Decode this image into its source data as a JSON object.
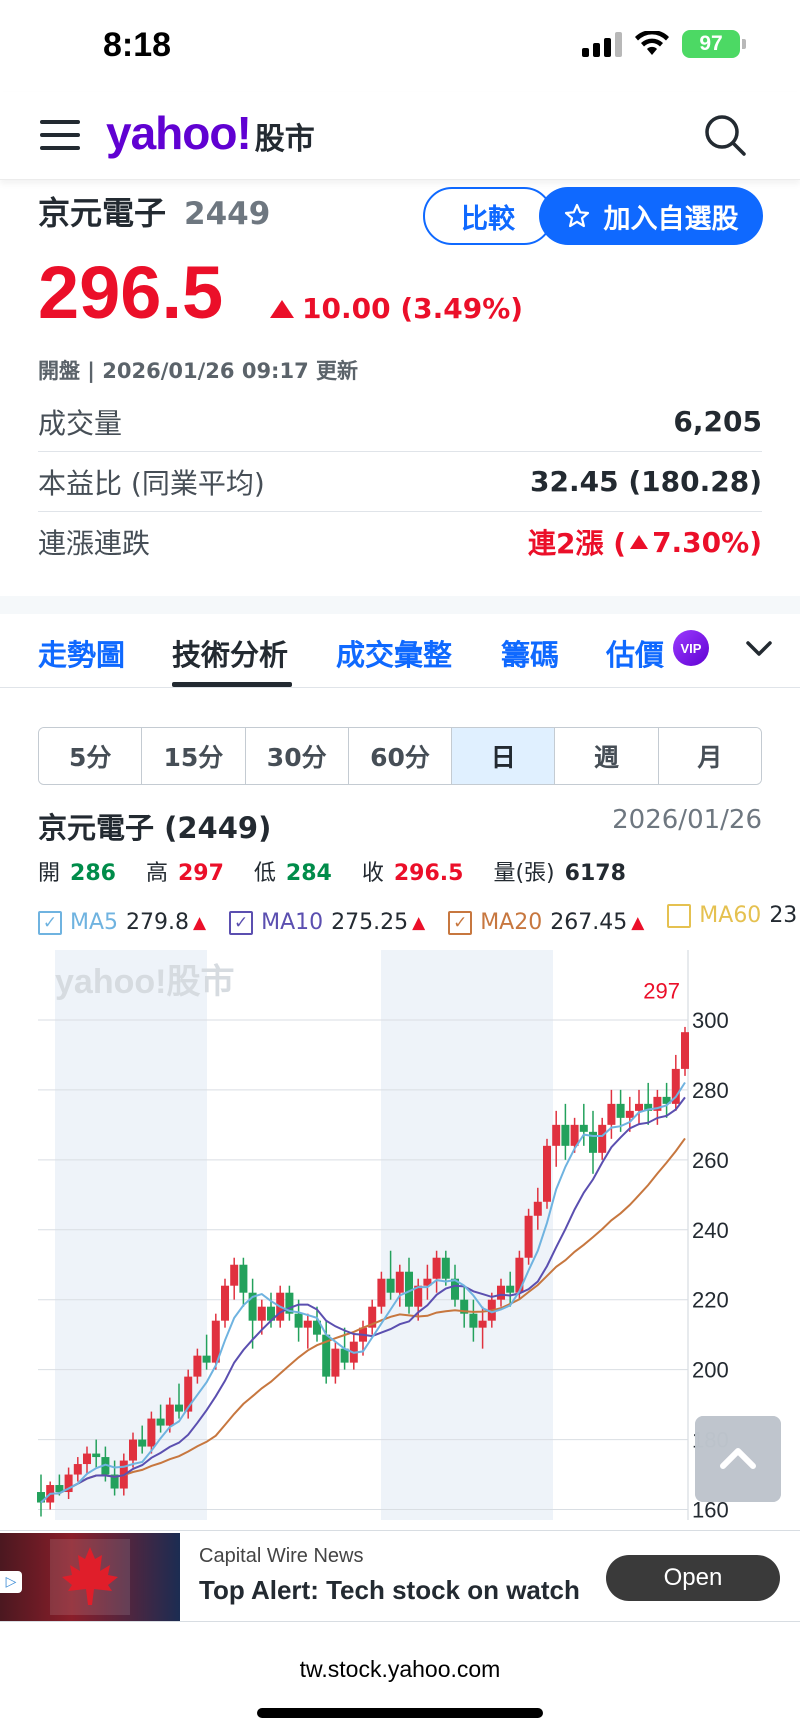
{
  "status_bar": {
    "time": "8:18",
    "battery": "97"
  },
  "header": {
    "logo_main": "yahoo!",
    "logo_sub": "股市"
  },
  "quote": {
    "name": "京元電子",
    "code": "2449",
    "compare_label": "比較",
    "watch_label": "加入自選股",
    "price": "296.5",
    "change": "10.00 (3.49%)",
    "update_info": "開盤 | 2026/01/26 09:17 更新",
    "stats": [
      {
        "label": "成交量",
        "value": "6,205"
      },
      {
        "label": "本益比 (同業平均)",
        "value": "32.45 (180.28)"
      },
      {
        "label": "連漲連跌",
        "value_prefix": "連2漲 (",
        "value_pct": "7.30%)"
      }
    ]
  },
  "tabs": [
    "走勢圖",
    "技術分析",
    "成交彙整",
    "籌碼",
    "估價"
  ],
  "vip_badge": "VIP",
  "periods": [
    "5分",
    "15分",
    "30分",
    "60分",
    "日",
    "週",
    "月"
  ],
  "active_period": "日",
  "chart_header": {
    "title": "京元電子 (2449)",
    "date": "2026/01/26",
    "open_label": "開",
    "open": "286",
    "high_label": "高",
    "high": "297",
    "low_label": "低",
    "low": "284",
    "close_label": "收",
    "close": "296.5",
    "volume_label": "量(張)",
    "volume": "6178"
  },
  "ma_legend": [
    {
      "name": "MA5",
      "value": "279.8",
      "color": "#6fb3e0"
    },
    {
      "name": "MA10",
      "value": "275.25",
      "color": "#5b4fb0"
    },
    {
      "name": "MA20",
      "value": "267.45",
      "color": "#c7773f"
    },
    {
      "name": "MA60",
      "value": "23",
      "color": "#e5c150"
    }
  ],
  "chart_data": {
    "type": "candlestick",
    "watermark": "yahoo!股市",
    "y_ticks": [
      300,
      280,
      260,
      240,
      220,
      200,
      180,
      160
    ],
    "ylim": [
      157,
      320
    ],
    "max_label": "297",
    "up_color": "#e0313f",
    "down_color": "#23a15c",
    "candles": [
      [
        165,
        170,
        158,
        162
      ],
      [
        162,
        168,
        160,
        167
      ],
      [
        167,
        170,
        164,
        165
      ],
      [
        165,
        172,
        163,
        170
      ],
      [
        170,
        175,
        168,
        173
      ],
      [
        173,
        178,
        170,
        176
      ],
      [
        176,
        180,
        172,
        175
      ],
      [
        175,
        178,
        168,
        170
      ],
      [
        170,
        174,
        164,
        166
      ],
      [
        166,
        176,
        164,
        174
      ],
      [
        174,
        182,
        172,
        180
      ],
      [
        180,
        184,
        176,
        178
      ],
      [
        178,
        188,
        176,
        186
      ],
      [
        186,
        190,
        182,
        184
      ],
      [
        184,
        192,
        182,
        190
      ],
      [
        190,
        196,
        186,
        188
      ],
      [
        188,
        200,
        186,
        198
      ],
      [
        198,
        206,
        196,
        204
      ],
      [
        204,
        210,
        200,
        202
      ],
      [
        202,
        216,
        200,
        214
      ],
      [
        214,
        226,
        212,
        224
      ],
      [
        224,
        232,
        220,
        230
      ],
      [
        230,
        232,
        218,
        222
      ],
      [
        222,
        226,
        206,
        214
      ],
      [
        214,
        220,
        210,
        218
      ],
      [
        218,
        222,
        212,
        214
      ],
      [
        214,
        224,
        212,
        222
      ],
      [
        222,
        224,
        214,
        216
      ],
      [
        216,
        220,
        208,
        212
      ],
      [
        212,
        216,
        206,
        214
      ],
      [
        214,
        218,
        208,
        210
      ],
      [
        210,
        214,
        196,
        198
      ],
      [
        198,
        208,
        196,
        206
      ],
      [
        206,
        212,
        200,
        202
      ],
      [
        202,
        210,
        200,
        208
      ],
      [
        208,
        214,
        204,
        212
      ],
      [
        212,
        220,
        210,
        218
      ],
      [
        218,
        228,
        216,
        226
      ],
      [
        226,
        234,
        220,
        222
      ],
      [
        222,
        230,
        218,
        228
      ],
      [
        228,
        232,
        216,
        218
      ],
      [
        218,
        226,
        214,
        224
      ],
      [
        224,
        230,
        220,
        226
      ],
      [
        226,
        234,
        222,
        232
      ],
      [
        232,
        234,
        224,
        226
      ],
      [
        226,
        230,
        218,
        220
      ],
      [
        220,
        224,
        212,
        216
      ],
      [
        216,
        220,
        208,
        212
      ],
      [
        212,
        218,
        206,
        214
      ],
      [
        214,
        222,
        212,
        220
      ],
      [
        220,
        226,
        218,
        224
      ],
      [
        224,
        228,
        218,
        222
      ],
      [
        222,
        234,
        220,
        232
      ],
      [
        232,
        246,
        230,
        244
      ],
      [
        244,
        252,
        240,
        248
      ],
      [
        248,
        266,
        246,
        264
      ],
      [
        264,
        274,
        258,
        270
      ],
      [
        270,
        276,
        260,
        264
      ],
      [
        264,
        272,
        262,
        270
      ],
      [
        270,
        276,
        264,
        268
      ],
      [
        268,
        274,
        256,
        262
      ],
      [
        262,
        272,
        260,
        270
      ],
      [
        270,
        280,
        266,
        276
      ],
      [
        276,
        280,
        268,
        272
      ],
      [
        272,
        278,
        268,
        274
      ],
      [
        274,
        280,
        270,
        276
      ],
      [
        276,
        282,
        270,
        274
      ],
      [
        274,
        280,
        270,
        278
      ],
      [
        278,
        282,
        272,
        276
      ],
      [
        276,
        290,
        274,
        286
      ],
      [
        286,
        298,
        284,
        296.5
      ]
    ]
  },
  "ad": {
    "source": "Capital Wire News",
    "headline": "Top Alert: Tech stock on watch",
    "open_label": "Open"
  },
  "url": "tw.stock.yahoo.com"
}
